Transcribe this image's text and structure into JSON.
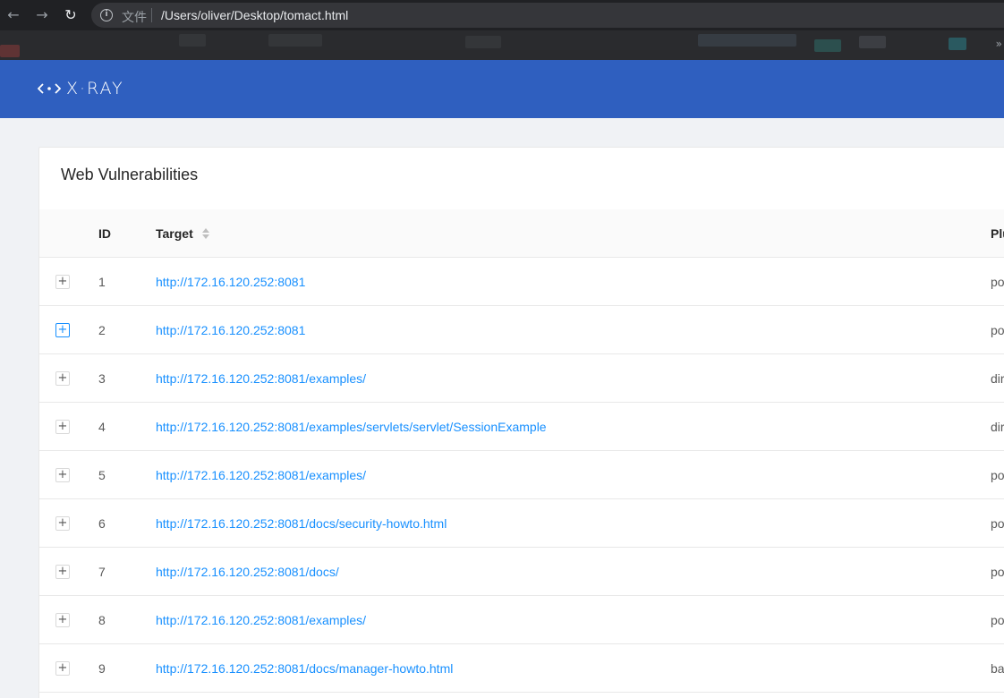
{
  "browser": {
    "back_icon": "←",
    "forward_icon": "→",
    "reload_icon": "↻",
    "info_icon": "i",
    "file_label": "文件",
    "url": "/Users/oliver/Desktop/tomact.html",
    "bookmarks_more": "»"
  },
  "app": {
    "logo_text": "X·RAY",
    "brand_color": "#2f5fbf"
  },
  "card": {
    "title": "Web Vulnerabilities"
  },
  "table": {
    "columns": {
      "id": "ID",
      "target": "Target",
      "plugin": "Plu"
    },
    "rows": [
      {
        "expand": "+",
        "id": "1",
        "target": "http://172.16.120.252:8081",
        "plugin": "po"
      },
      {
        "expand": "+",
        "id": "2",
        "target": "http://172.16.120.252:8081",
        "plugin": "po"
      },
      {
        "expand": "+",
        "id": "3",
        "target": "http://172.16.120.252:8081/examples/",
        "plugin": "dir"
      },
      {
        "expand": "+",
        "id": "4",
        "target": "http://172.16.120.252:8081/examples/servlets/servlet/SessionExample",
        "plugin": "dir"
      },
      {
        "expand": "+",
        "id": "5",
        "target": "http://172.16.120.252:8081/examples/",
        "plugin": "po"
      },
      {
        "expand": "+",
        "id": "6",
        "target": "http://172.16.120.252:8081/docs/security-howto.html",
        "plugin": "po"
      },
      {
        "expand": "+",
        "id": "7",
        "target": "http://172.16.120.252:8081/docs/",
        "plugin": "po"
      },
      {
        "expand": "+",
        "id": "8",
        "target": "http://172.16.120.252:8081/examples/",
        "plugin": "po"
      },
      {
        "expand": "+",
        "id": "9",
        "target": "http://172.16.120.252:8081/docs/manager-howto.html",
        "plugin": "ba"
      }
    ]
  }
}
